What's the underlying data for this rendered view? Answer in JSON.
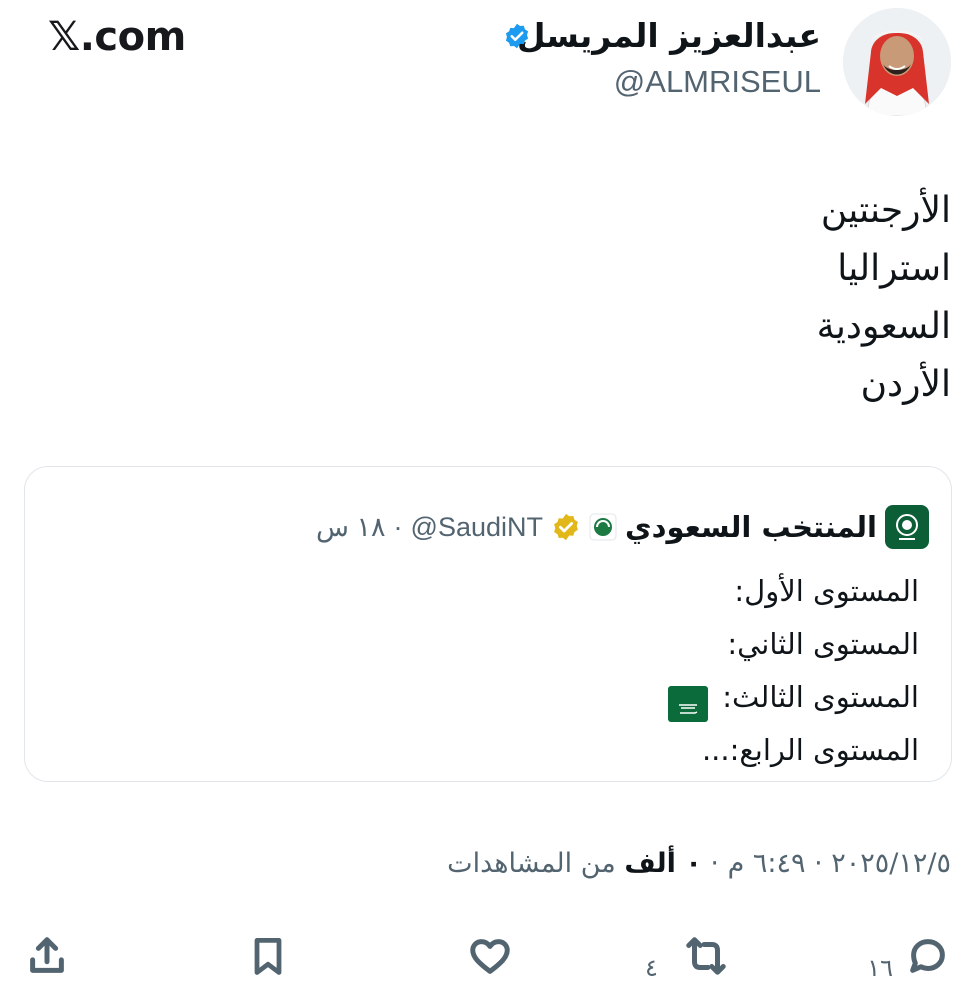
{
  "source": {
    "brand": "𝕏.com"
  },
  "author": {
    "display_name": "عبدالعزيز المريسل",
    "handle": "@ALMRISEUL",
    "verified_color": "#1d9bf0"
  },
  "tweet": {
    "lines": [
      "الأرجنتين",
      "استراليا",
      "السعودية",
      "الأردن"
    ]
  },
  "quote": {
    "name": "المنتخب السعودي",
    "handle": "@SaudiNT",
    "dot": "·",
    "time": "١٨ س",
    "badge_color": "#e2b719",
    "lines": [
      "المستوى الأول:",
      "المستوى الثاني:",
      "المستوى الثالث:",
      "المستوى الرابع:..."
    ]
  },
  "meta": {
    "date": "٢٠٢٥/١٢/٥",
    "sep1": "·",
    "time": "٦:٤٩ م",
    "sep2": "·",
    "views_count": "٠ ألف",
    "views_label": "من المشاهدات"
  },
  "actions": {
    "reply_count": "١٦",
    "retweet_count": "٤"
  }
}
